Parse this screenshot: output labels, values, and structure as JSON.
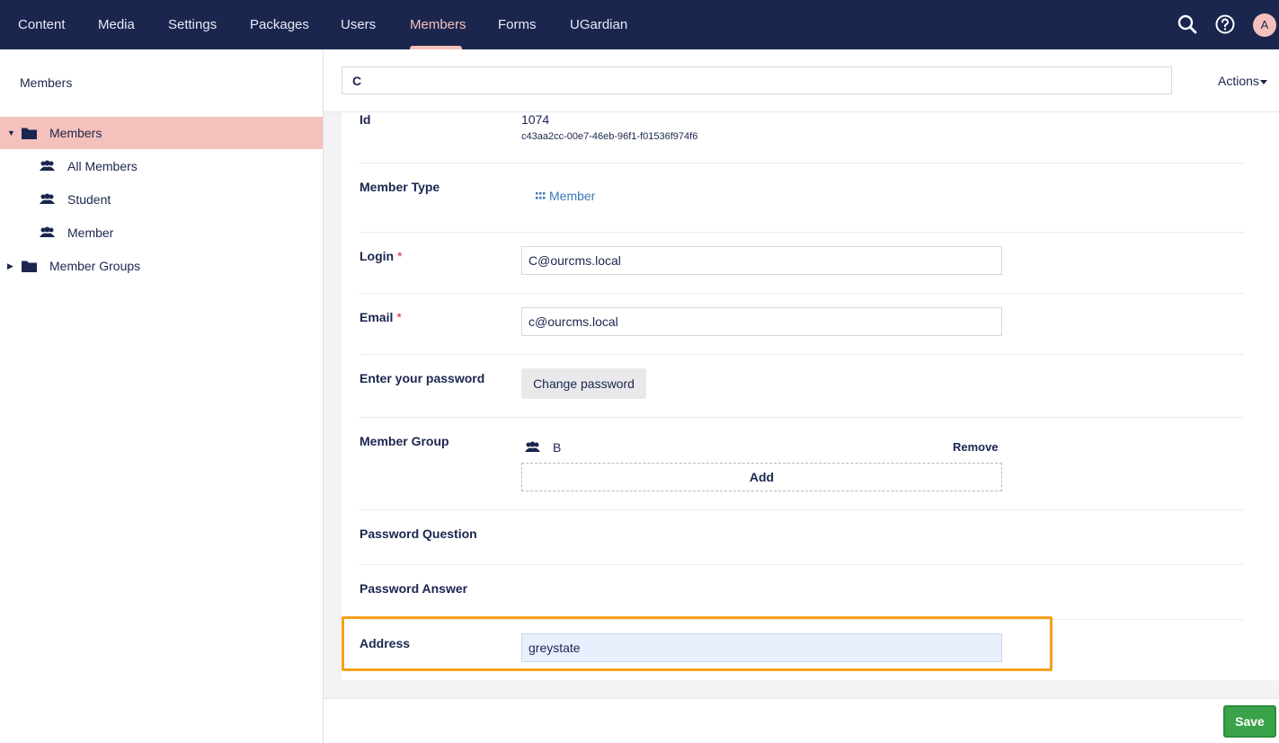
{
  "nav": {
    "items": [
      "Content",
      "Media",
      "Settings",
      "Packages",
      "Users",
      "Members",
      "Forms",
      "UGardian"
    ],
    "active": "Members",
    "avatar_initial": "A"
  },
  "sidebar": {
    "title": "Members",
    "tree": [
      {
        "label": "Members",
        "icon": "folder-icon",
        "selected": true,
        "expanded": true
      },
      {
        "label": "All Members",
        "icon": "users-icon"
      },
      {
        "label": "Student",
        "icon": "users-icon"
      },
      {
        "label": "Member",
        "icon": "users-icon"
      },
      {
        "label": "Member Groups",
        "icon": "folder-icon",
        "expanded": false
      }
    ]
  },
  "editor": {
    "name_value": "C",
    "actions_label": "Actions",
    "id": {
      "label": "Id",
      "value": "1074",
      "guid": "c43aa2cc-00e7-46eb-96f1-f01536f974f6"
    },
    "member_type": {
      "label": "Member Type",
      "value": "Member"
    },
    "login": {
      "label": "Login",
      "required": "*",
      "value": "C@ourcms.local"
    },
    "email": {
      "label": "Email",
      "required": "*",
      "value": "c@ourcms.local"
    },
    "password": {
      "label": "Enter your password",
      "button": "Change password"
    },
    "member_group": {
      "label": "Member Group",
      "group_name": "B",
      "remove_label": "Remove",
      "add_label": "Add"
    },
    "password_question": {
      "label": "Password Question"
    },
    "password_answer": {
      "label": "Password Answer"
    },
    "address": {
      "label": "Address",
      "value": "greystate"
    },
    "save_label": "Save"
  },
  "colors": {
    "nav_bg": "#1b264f",
    "accent_pink": "#f5c1bc",
    "highlight_orange": "#f5a01b",
    "save_green": "#3aa34a",
    "link_blue": "#3879ba"
  }
}
